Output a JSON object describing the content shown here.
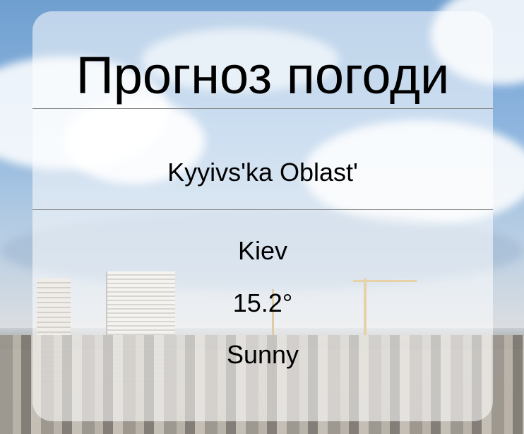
{
  "forecast": {
    "title": "Прогноз погоди",
    "region": "Kyyivs'ka Oblast'",
    "city": "Kiev",
    "temperature": "15.2°",
    "condition": "Sunny"
  },
  "background": {
    "description_icon": "city-skyline-photo"
  }
}
